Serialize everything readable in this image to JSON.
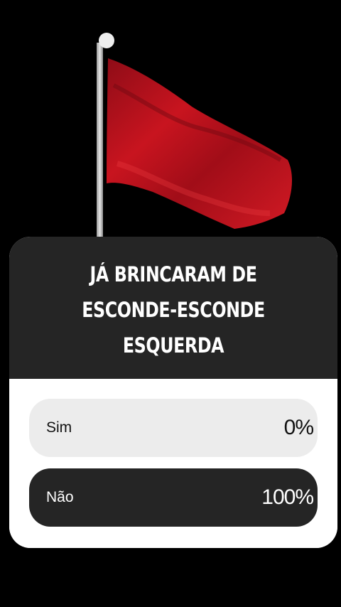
{
  "background_color": "#000000",
  "flag": {
    "color": "#c1121f",
    "pole_color": "#dcdcdc"
  },
  "poll": {
    "question_lines": [
      "JÁ BRINCARAM DE",
      "ESCONDE-ESCONDE",
      "ESQUERDA"
    ],
    "header_color": "#252525",
    "options": [
      {
        "label": "Sim",
        "percent_text": "0%",
        "percent": 0
      },
      {
        "label": "Não",
        "percent_text": "100%",
        "percent": 100
      }
    ]
  }
}
